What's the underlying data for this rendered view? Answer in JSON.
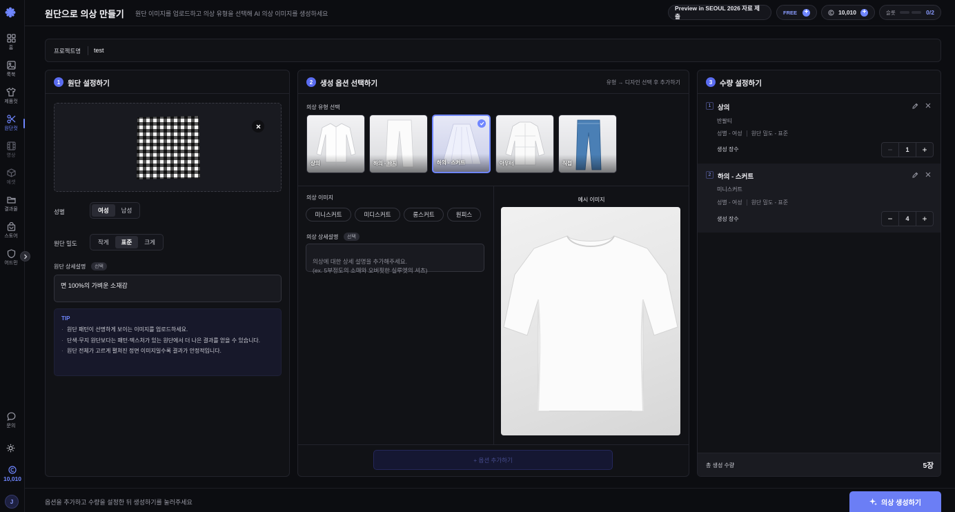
{
  "sidebar": {
    "items": [
      {
        "label": "홈",
        "icon": "grid-icon"
      },
      {
        "label": "룩북",
        "icon": "image-icon"
      },
      {
        "label": "제품컷",
        "icon": "shirt-icon"
      },
      {
        "label": "원단컷",
        "icon": "scissors-icon"
      },
      {
        "label": "영상",
        "icon": "film-icon"
      },
      {
        "label": "에셋",
        "icon": "cube-icon"
      },
      {
        "label": "결과물",
        "icon": "folder-icon"
      },
      {
        "label": "스토어",
        "icon": "bag-icon"
      },
      {
        "label": "어드민",
        "icon": "shield-icon"
      },
      {
        "label": "문의",
        "icon": "chat-icon"
      }
    ],
    "credits": "10,010",
    "avatar": "J"
  },
  "header": {
    "title": "원단으로 의상 만들기",
    "subtitle": "원단 이미지를 업로드하고 의상 유형을 선택해 AI 의상 이미지를 생성하세요",
    "preview_button": "Preview in SEOUL 2026 자료 제출",
    "plan": "FREE",
    "credits": "10,010",
    "slot_label": "슬롯",
    "slot_count": "0/2"
  },
  "project": {
    "label": "프로젝트명",
    "value": "test"
  },
  "fabric_panel": {
    "step": "1",
    "title": "원단 설정하기",
    "gender_label": "성별",
    "gender_options": [
      "여성",
      "남성"
    ],
    "gender_selected": "여성",
    "density_label": "원단 밀도",
    "density_options": [
      "작게",
      "표준",
      "크게"
    ],
    "density_selected": "표준",
    "desc_label": "원단 상세설명",
    "desc_badge": "선택",
    "desc_value": "면 100%의 가벼운 소재감",
    "tip_title": "TIP",
    "tips": [
      "원단 패턴이 선명하게 보이는 이미지를 업로드하세요.",
      "단색·무지 원단보다는 패턴·텍스처가 있는 원단에서 더 나은 결과를 얻을 수 있습니다.",
      "원단 전체가 고르게 펼쳐진 정면 이미지일수록 결과가 안정적입니다."
    ]
  },
  "options_panel": {
    "step": "2",
    "title": "생성 옵션 선택하기",
    "hint": "유형 → 디자인 선택 후 추가하기",
    "type_label": "의상 유형 선택",
    "types": [
      {
        "label": "상의",
        "icon": "blouse-icon"
      },
      {
        "label": "하의 - 바지",
        "icon": "pants-icon"
      },
      {
        "label": "하의 - 스커트",
        "icon": "skirt-icon"
      },
      {
        "label": "아우터",
        "icon": "jacket-icon"
      },
      {
        "label": "직접",
        "icon": "jeans-icon"
      }
    ],
    "type_selected": "하의 - 스커트",
    "image_label": "의상 이미지",
    "image_chips": [
      "미니스커트",
      "미디스커트",
      "롱스커트",
      "원피스"
    ],
    "detail_label": "의상 상세설명",
    "detail_badge": "선택",
    "detail_placeholder": "의상에 대한 상세 설명을 추가해주세요.\n(ex. 5부정도의 소매와 오버핏한 실루엣의 셔츠)",
    "example_label": "예시 이미지",
    "add_button": "+ 옵션 추가하기"
  },
  "quantity_panel": {
    "step": "3",
    "title": "수량 설정하기",
    "items": [
      {
        "index": "1",
        "title": "상의",
        "sub": "반팔티",
        "gender": "성별 - 여성",
        "density": "원단 밀도 - 표준",
        "count_label": "생성 장수",
        "count": "1"
      },
      {
        "index": "2",
        "title": "하의 - 스커트",
        "sub": "미니스커트",
        "gender": "성별 - 여성",
        "density": "원단 밀도 - 표준",
        "count_label": "생성 장수",
        "count": "4"
      }
    ],
    "total_label": "총 생성 수량",
    "total_value": "5장"
  },
  "footer": {
    "hint": "옵션을 추가하고 수량을 설정한 뒤 생성하기를 눌러주세요",
    "generate_button": "의상 생성하기"
  },
  "colors": {
    "accent": "#6f86ff",
    "background": "#0c0d11",
    "panel": "#111216"
  }
}
